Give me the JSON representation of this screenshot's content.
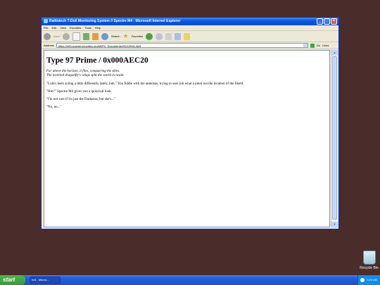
{
  "window": {
    "title": "Railtutech T-Doll Monitoring System // Spectre M4 - Microsoft Internet Explorer",
    "menu": [
      "File",
      "Edit",
      "View",
      "Favorites",
      "Tools",
      "Help"
    ]
  },
  "toolbar": {
    "back": "Back",
    "search": "Search",
    "favorites": "Favorites"
  },
  "address": {
    "label": "Address",
    "url": "https://e02ozowml.neocities.org/M0P4_Documents/20210916.html",
    "go": "Go",
    "links": "Links"
  },
  "page": {
    "heading": "Type 97 Prime / 0x000AEC20",
    "epigraph_1": "Far above the horizon, it flies, conquering the skies.",
    "epigraph_2": "The inverted dragonfly's wings split the world in twain.",
    "p1": "\"Lulu's been acting a little differently lately, huh.\" You fiddle with the antennas, trying to suss (oh what a joke) out the location of the Skeld.",
    "p2": "\"Hm?\" Spectre M4 gives you a quizzical look.",
    "p3": "\"I'm not sure if it's just the Darkness, but she's...\"",
    "p4": "\"No, no...\""
  },
  "desktop": {
    "recycle_bin": "Recycle Bin"
  },
  "taskbar": {
    "start": "start",
    "task": "null - Micros...",
    "clock": "5:20 AM"
  }
}
